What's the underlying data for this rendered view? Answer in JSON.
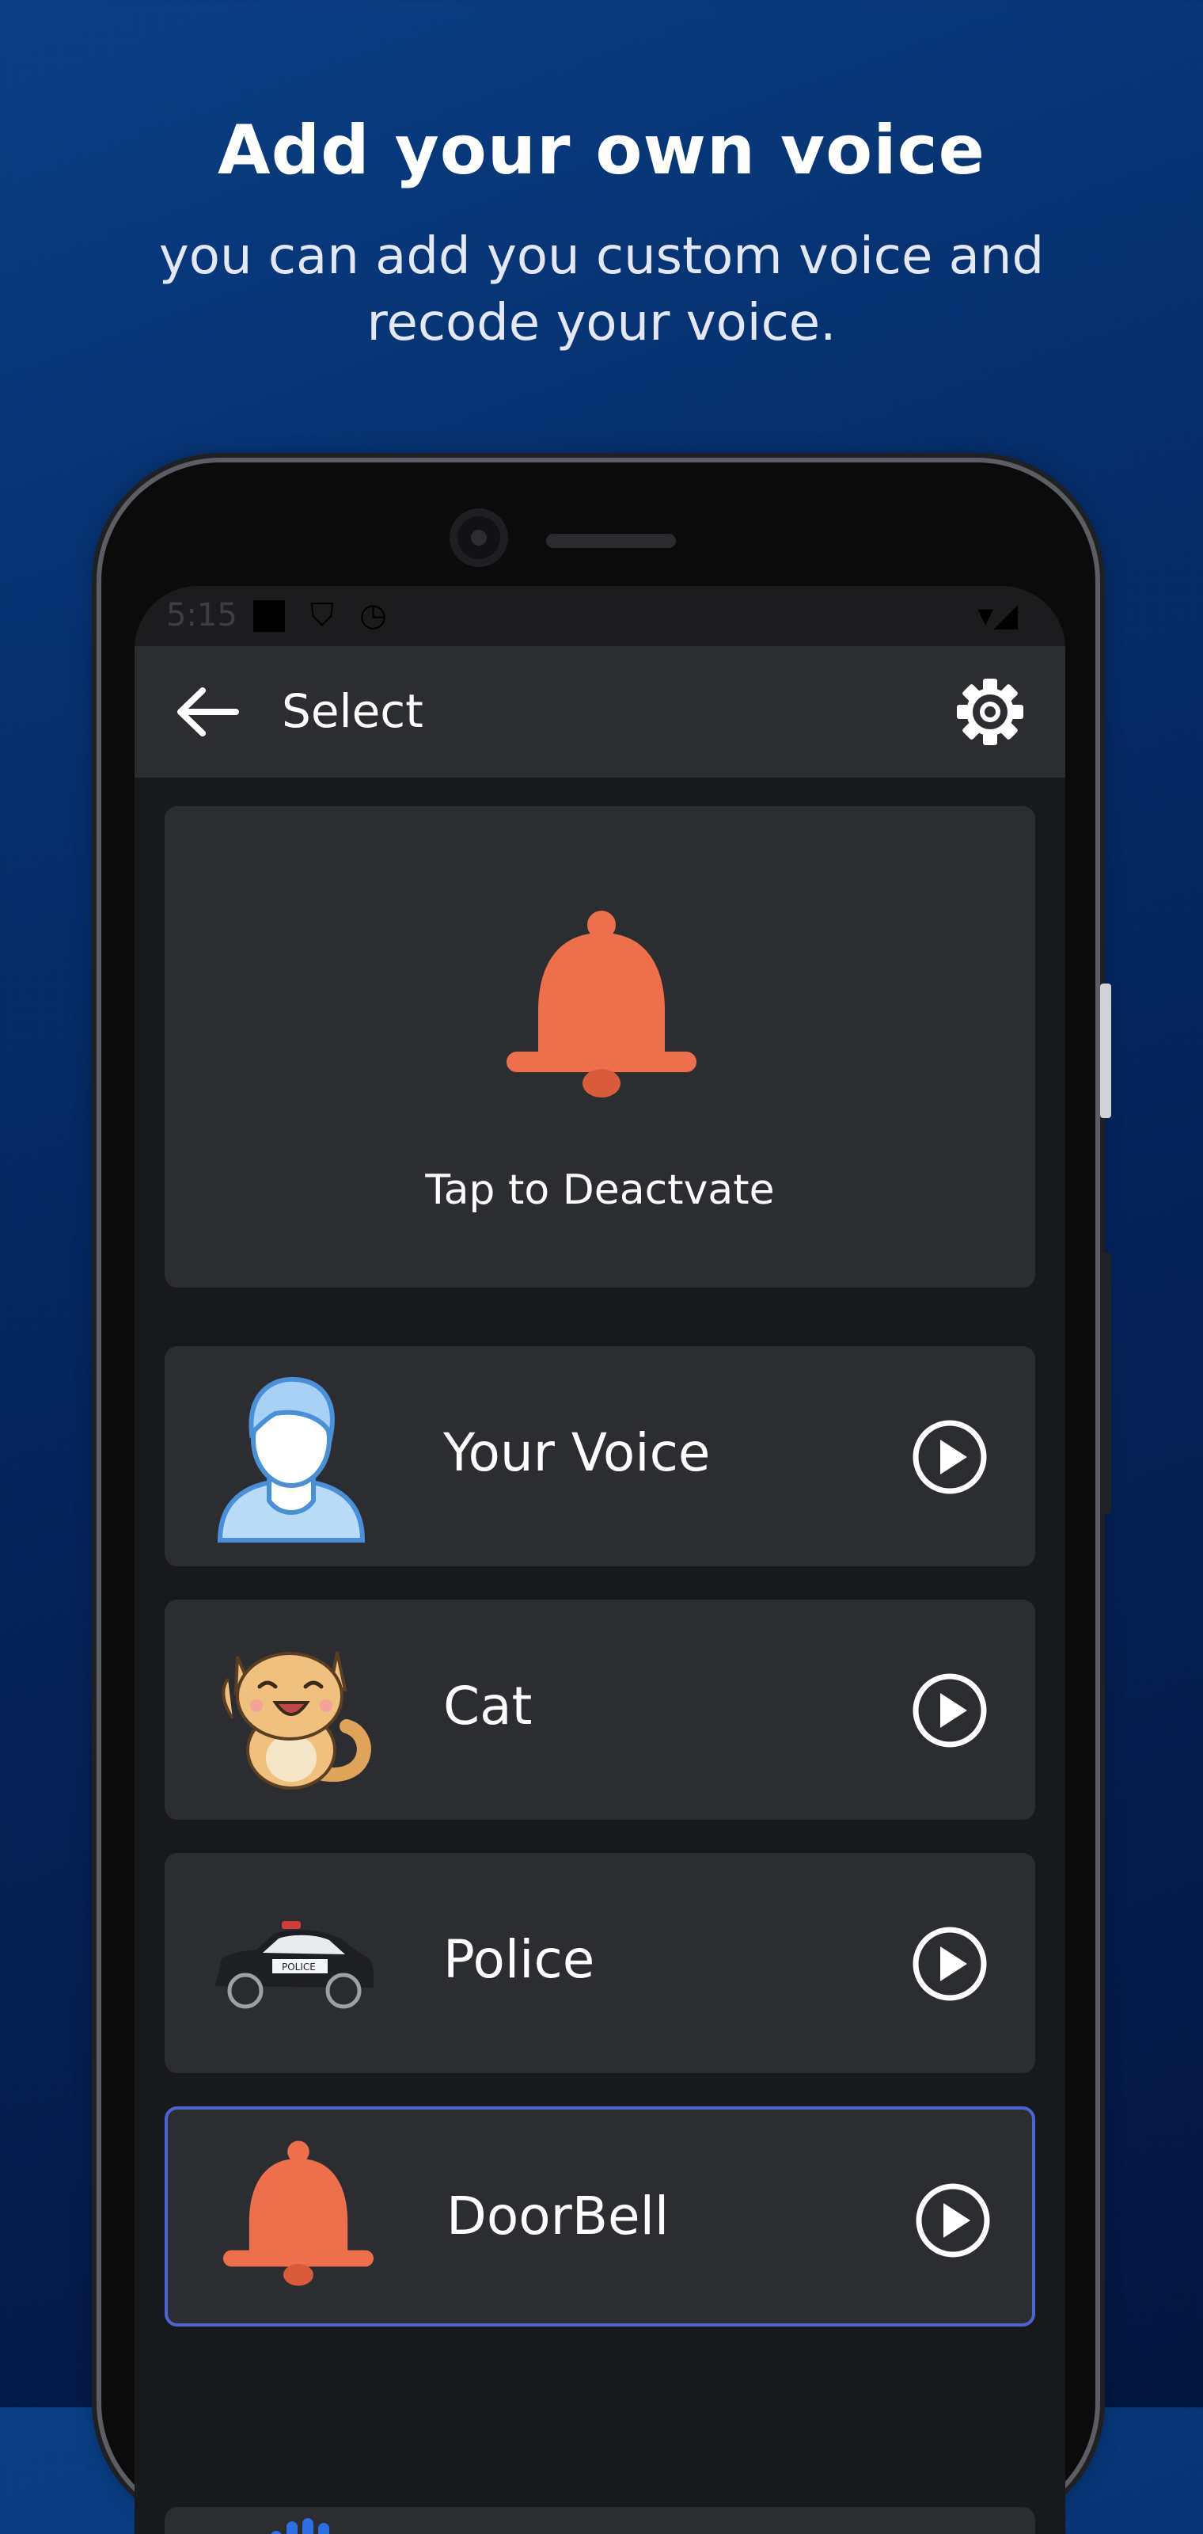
{
  "promo": {
    "headline": "Add your own voice",
    "subline": "you can add you custom voice and recode your voice."
  },
  "status_bar": {
    "time": "5:15"
  },
  "app_bar": {
    "title": "Select",
    "back_icon": "arrow-left-icon",
    "settings_icon": "gear-icon"
  },
  "hero": {
    "icon": "bell-icon",
    "label": "Tap to Deactvate"
  },
  "sounds": [
    {
      "label": "Your Voice",
      "icon": "person-avatar-icon",
      "selected": false
    },
    {
      "label": "Cat",
      "icon": "cat-icon",
      "selected": false
    },
    {
      "label": "Police",
      "icon": "police-car-icon",
      "selected": false
    },
    {
      "label": "DoorBell",
      "icon": "bell-icon",
      "selected": true
    }
  ],
  "colors": {
    "accent_bell": "#ee6f4c",
    "selected_border": "#4d63d8",
    "card_bg": "#2c2d31",
    "screen_bg": "#18191b"
  }
}
